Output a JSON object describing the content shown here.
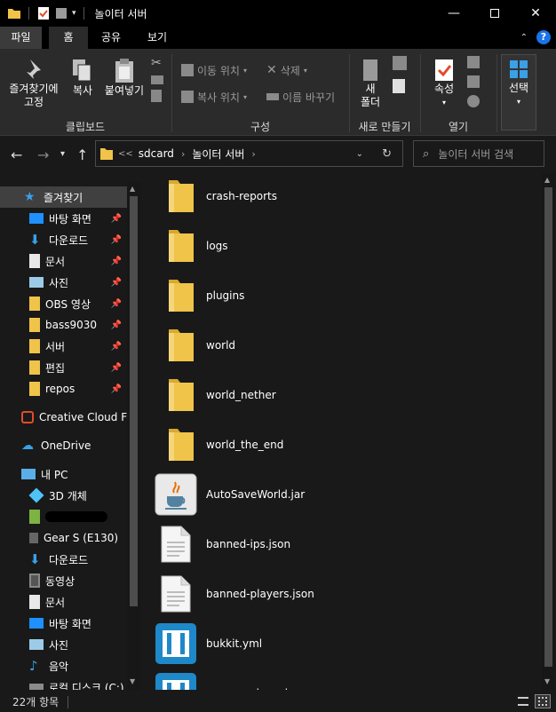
{
  "window": {
    "title": "놀이터 서버",
    "controls": [
      "minimize",
      "maximize",
      "close"
    ]
  },
  "ribbon_tabs": [
    "파일",
    "홈",
    "공유",
    "보기"
  ],
  "ribbon": {
    "clipboard": {
      "pin_label_1": "즐겨찾기에",
      "pin_label_2": "고정",
      "copy_label": "복사",
      "paste_label": "붙여넣기",
      "group_label": "클립보드"
    },
    "organize": {
      "move_to": "이동 위치",
      "copy_to": "복사 위치",
      "delete": "삭제",
      "rename": "이름 바꾸기",
      "group_label": "구성"
    },
    "new": {
      "new_folder_1": "새",
      "new_folder_2": "폴더",
      "group_label": "새로 만들기"
    },
    "open": {
      "properties": "속성",
      "group_label": "열기"
    },
    "select": {
      "select_label": "선택"
    }
  },
  "address": {
    "overflow": "<<",
    "crumbs": [
      "sdcard",
      "놀이터 서버"
    ]
  },
  "search": {
    "placeholder": "놀이터 서버 검색"
  },
  "nav_pane": {
    "quick_access": "즐겨찾기",
    "pinned": [
      "바탕 화면",
      "다운로드",
      "문서",
      "사진",
      "OBS 영상",
      "bass9030",
      "서버",
      "편집",
      "repos"
    ],
    "creative_cloud": "Creative Cloud Fil",
    "onedrive": "OneDrive",
    "this_pc": "내 PC",
    "pc_items": [
      "3D 개체",
      "",
      "Gear S (E130)",
      "다운로드",
      "동영상",
      "문서",
      "바탕 화면",
      "사진",
      "음악",
      "로컬 디스크 (C:)"
    ]
  },
  "files": [
    {
      "name": "crash-reports",
      "type": "folder"
    },
    {
      "name": "logs",
      "type": "folder"
    },
    {
      "name": "plugins",
      "type": "folder"
    },
    {
      "name": "world",
      "type": "folder"
    },
    {
      "name": "world_nether",
      "type": "folder"
    },
    {
      "name": "world_the_end",
      "type": "folder"
    },
    {
      "name": "AutoSaveWorld.jar",
      "type": "jar"
    },
    {
      "name": "banned-ips.json",
      "type": "document"
    },
    {
      "name": "banned-players.json",
      "type": "document"
    },
    {
      "name": "bukkit.yml",
      "type": "yml"
    },
    {
      "name": "commands.yml",
      "type": "yml"
    }
  ],
  "status": {
    "item_count": "22개 항목"
  },
  "colors": {
    "folder": "#f0c349",
    "accent": "#1a73e8",
    "background": "#191919",
    "ribbon": "#2b2b2b"
  }
}
